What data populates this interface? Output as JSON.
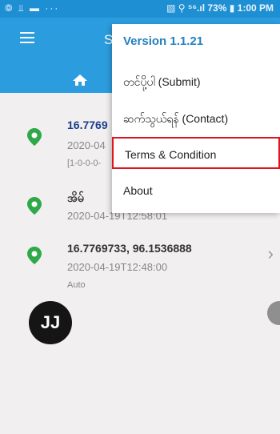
{
  "status_bar": {
    "left_icons": "⦾ ⫫ ▬ ···",
    "right_text": "▧ ⚲ ⁵⁶.ıl 73% ▮ 1:00 PM"
  },
  "app_bar": {
    "title": "S"
  },
  "icons": {
    "menu": "hamburger-icon",
    "home": "home-icon",
    "pin": "location-pin-icon",
    "chevron": "chevron-right-icon"
  },
  "list_items": [
    {
      "title": "16.7769",
      "date": "2020-04",
      "meta": "[1-0-0-0-"
    },
    {
      "title": "အိမ်",
      "date": "2020-04-19T12:58:01"
    },
    {
      "title": "16.7769733, 96.1536888",
      "date": "2020-04-19T12:48:00",
      "meta": "Auto"
    }
  ],
  "avatar": {
    "initials": "JJ"
  },
  "menu": {
    "version": "Version 1.1.21",
    "submit": "တင်ပို့ပါ (Submit)",
    "contact": "ဆက်သွယ်ရန် (Contact)",
    "terms": "Terms & Condition",
    "about": "About"
  },
  "colors": {
    "primary": "#2b9ddf",
    "status_bar": "#1f8fd3",
    "pin_green": "#2fa84a",
    "highlight": "#e0141d",
    "version_text": "#2380bf"
  }
}
